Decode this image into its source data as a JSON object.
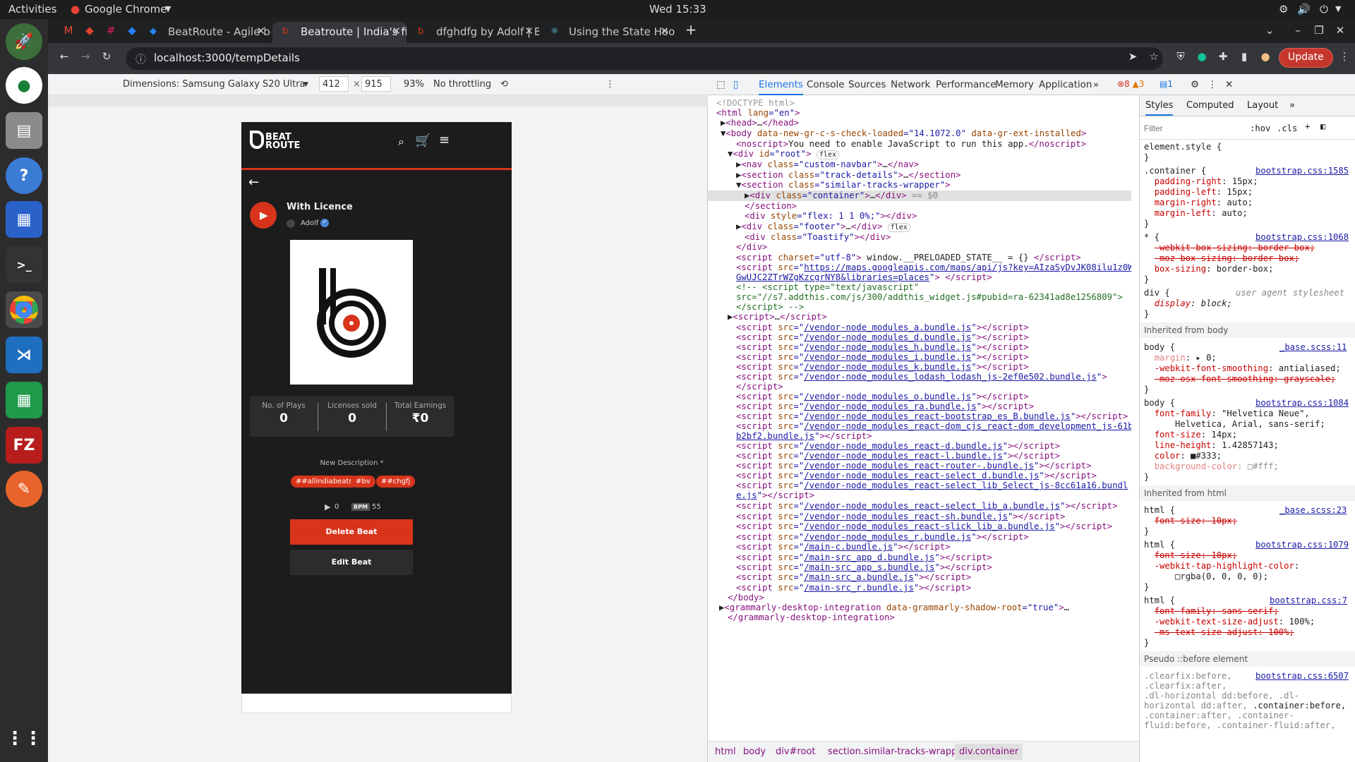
{
  "os": {
    "activities": "Activities",
    "app": "Google Chrome",
    "clock": "Wed 15:33"
  },
  "browser": {
    "tabs": [
      "BeatRoute - Agile board -",
      "Beatroute | India's first be",
      "dfghdfg by Adolf | Beatro",
      "Using the State Hook – Re"
    ],
    "url": "localhost:3000/tempDetails",
    "update_label": "Update"
  },
  "device_toolbar": {
    "dimensions": "Dimensions: Samsung Galaxy S20 Ultra",
    "width": "412",
    "height": "915",
    "zoom": "93%",
    "throttle": "No throttling"
  },
  "page": {
    "logo_text": "BEAT ROUTE",
    "track_title": "With Licence",
    "artist": "Adolf",
    "stats": [
      {
        "label": "No. of Plays",
        "value": "0"
      },
      {
        "label": "Licenses sold",
        "value": "0"
      },
      {
        "label": "Total Earnings",
        "value": "₹0"
      }
    ],
    "description_label": "New Description *",
    "tags": [
      "##allindiabeats",
      "#bv",
      "##chgfj"
    ],
    "plays": "0",
    "bpm_label": "BPM",
    "bpm": "55",
    "delete_label": "Delete Beat",
    "edit_label": "Edit Beat"
  },
  "devtools": {
    "tabs": [
      "Elements",
      "Console",
      "Sources",
      "Network",
      "Performance",
      "Memory",
      "Application"
    ],
    "errors": "8",
    "warnings": "3",
    "messages": "1",
    "style_tabs": [
      "Styles",
      "Computed",
      "Layout"
    ],
    "filter_placeholder": "Filter",
    "hov": ":hov",
    "cls": ".cls",
    "breadcrumbs": [
      "html",
      "body",
      "div#root",
      "section.similar-tracks-wrapper",
      "div.container"
    ],
    "inherited_body": "Inherited from body",
    "inherited_html": "Inherited from html",
    "pseudo": "Pseudo ::before element"
  }
}
